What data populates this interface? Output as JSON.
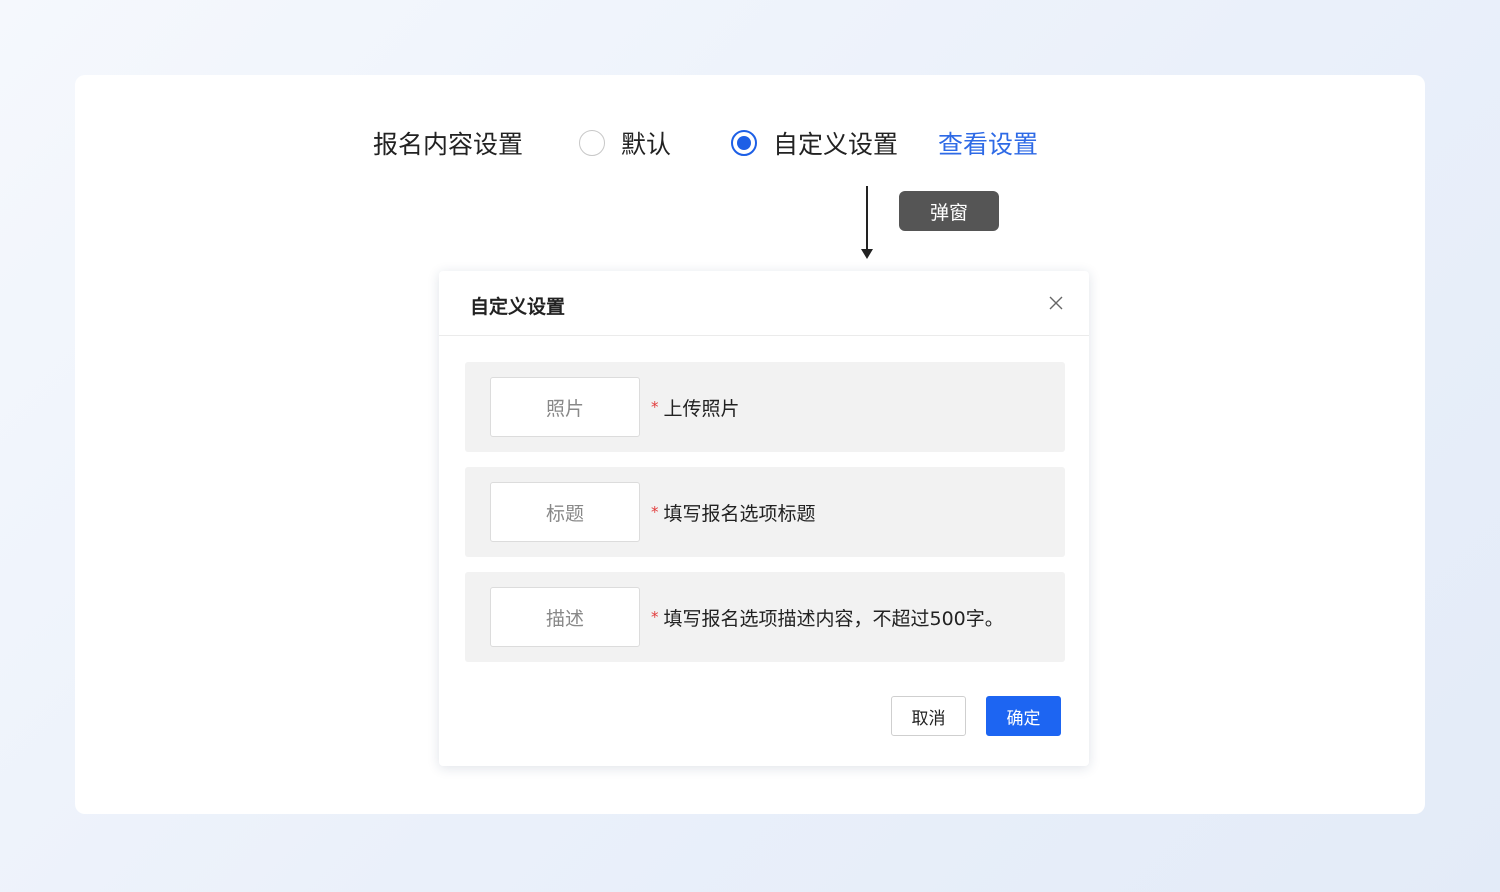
{
  "setting": {
    "label": "报名内容设置",
    "options": [
      {
        "label": "默认",
        "selected": false
      },
      {
        "label": "自定义设置",
        "selected": true
      }
    ],
    "view_link": "查看设置"
  },
  "annotation": {
    "tag": "弹窗"
  },
  "dialog": {
    "title": "自定义设置",
    "fields": [
      {
        "box_label": "照片",
        "required": "*",
        "description": "上传照片"
      },
      {
        "box_label": "标题",
        "required": "*",
        "description": "填写报名选项标题"
      },
      {
        "box_label": "描述",
        "required": "*",
        "description": "填写报名选项描述内容，不超过500字。"
      }
    ],
    "cancel_label": "取消",
    "confirm_label": "确定"
  },
  "colors": {
    "accent": "#1d65f2",
    "link": "#2e6ae6",
    "required": "#e23c3c",
    "tag_bg": "#555555"
  },
  "icons": {
    "close": "close-icon",
    "radio_checked": "radio-checked-icon",
    "radio_unchecked": "radio-unchecked-icon"
  }
}
